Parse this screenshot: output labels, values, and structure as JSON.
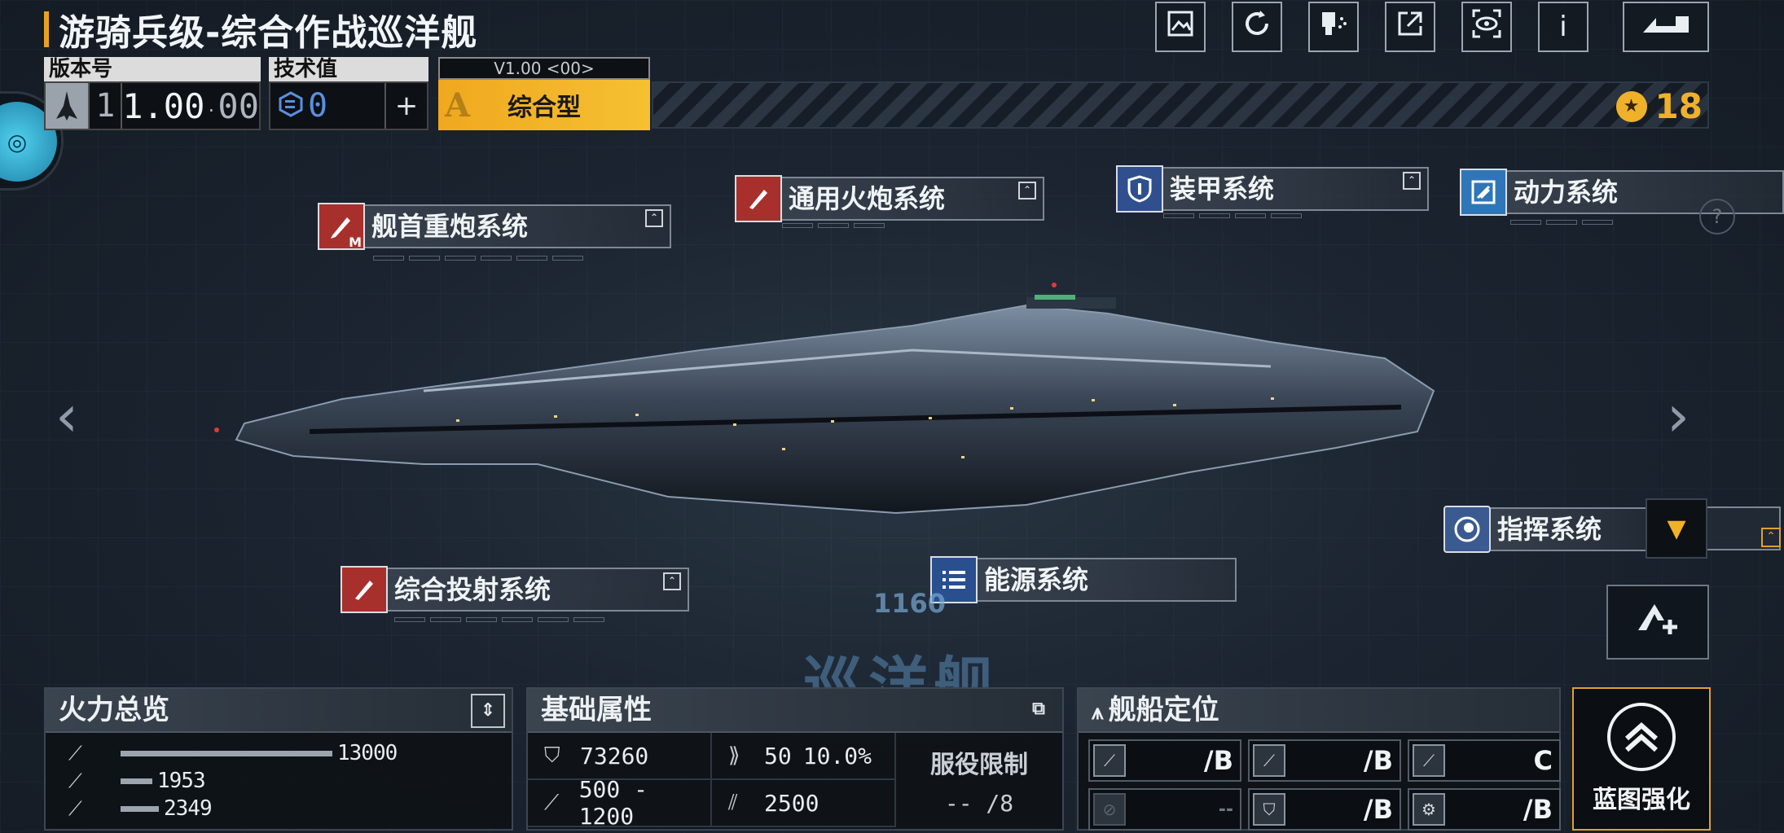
{
  "header": {
    "title": "游骑兵级-综合作战巡洋舰"
  },
  "toolbar": {
    "buttons": [
      {
        "icon": "gallery-icon"
      },
      {
        "icon": "refresh-icon"
      },
      {
        "icon": "paint-icon"
      },
      {
        "icon": "share-icon"
      },
      {
        "icon": "view-icon"
      },
      {
        "icon": "info-icon",
        "glyph": "i"
      },
      {
        "icon": "back-icon"
      }
    ]
  },
  "version": {
    "label": "版本号",
    "tier": "1",
    "number": "1.00",
    "suffix": "00"
  },
  "tech": {
    "label": "技术值",
    "value": "0"
  },
  "type": {
    "version_tag": "V1.00 <00>",
    "grade": "A",
    "name": "综合型"
  },
  "currency": {
    "value": "18"
  },
  "systems": {
    "bow_heavy_gun": {
      "label": "舰首重炮系统",
      "badge": "M"
    },
    "general_gun": {
      "label": "通用火炮系统"
    },
    "armor": {
      "label": "装甲系统"
    },
    "power": {
      "label": "动力系统"
    },
    "command": {
      "label": "指挥系统"
    },
    "projection": {
      "label": "综合投射系统"
    },
    "energy": {
      "label": "能源系统"
    }
  },
  "help": {
    "glyph": "?"
  },
  "ship": {
    "hull_number": "1160",
    "class_label": "巡洋舰"
  },
  "firepower": {
    "title": "火力总览",
    "rows": [
      {
        "value": "13000",
        "fraction": 1.0
      },
      {
        "value": "1953",
        "fraction": 0.15
      },
      {
        "value": "2349",
        "fraction": 0.18
      }
    ]
  },
  "attributes": {
    "title": "基础属性",
    "hp": "73260",
    "speed": "50",
    "evasion": "10.0%",
    "range": "500 - 1200",
    "cruise": "2500",
    "service_label": "服役限制",
    "service_value": "--  /8"
  },
  "positioning": {
    "title": "舰船定位",
    "cells": [
      {
        "grade": "/B",
        "dim": false
      },
      {
        "grade": "/B",
        "dim": false
      },
      {
        "grade": "C",
        "dim": false
      },
      {
        "grade": "--",
        "dim": true
      },
      {
        "grade": "/B",
        "dim": false
      },
      {
        "grade": "/B",
        "dim": false
      }
    ]
  },
  "blueprint": {
    "label": "蓝图强化"
  },
  "colors": {
    "accent": "#f0b12a",
    "weapon": "#a8302c",
    "armor": "#2f4f8f"
  }
}
